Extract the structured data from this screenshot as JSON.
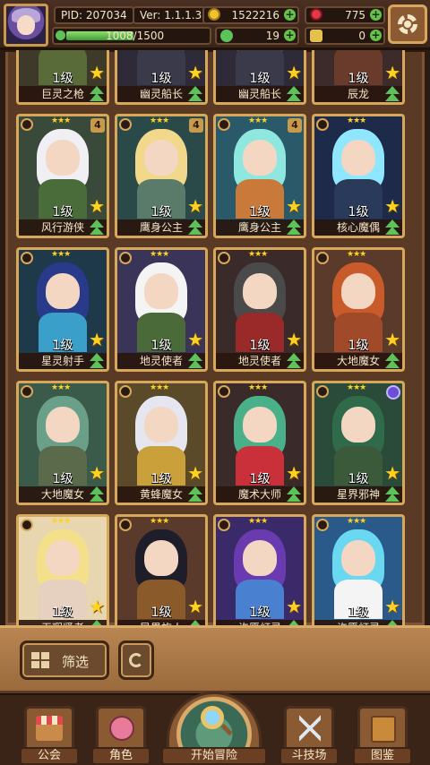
{
  "header": {
    "pid": "PID: 207034",
    "version": "Ver: 1.1.1.3",
    "coins": "1522216",
    "gems": "775",
    "xp_text": "1008/1500",
    "xp_progress": 0.672,
    "clovers": "19",
    "keys": "0",
    "plus": "+"
  },
  "cards": [
    {
      "name": "巨灵之枪",
      "level": "1级",
      "hair": "#7a3a2a",
      "body": "#5a6b3a",
      "bg": "#3d3a2a",
      "badge": ""
    },
    {
      "name": "幽灵船长",
      "level": "1级",
      "hair": "#4a4a5a",
      "body": "#3a3a4a",
      "bg": "#2e2a38",
      "badge": ""
    },
    {
      "name": "幽灵船长",
      "level": "1级",
      "hair": "#5a4a6a",
      "body": "#3a3a4a",
      "bg": "#2e2a38",
      "badge": ""
    },
    {
      "name": "辰龙",
      "level": "1级",
      "hair": "#4a2a2a",
      "body": "#6a3a2a",
      "bg": "#3d2a2a",
      "badge": ""
    },
    {
      "name": "风行游侠",
      "level": "1级",
      "hair": "#f0f0f4",
      "body": "#4a6b3a",
      "bg": "#3a4a3a",
      "badge": "4"
    },
    {
      "name": "鹰身公主",
      "level": "1级",
      "hair": "#f2d88a",
      "body": "#5a7a6a",
      "bg": "#2a4a4a",
      "badge": "4"
    },
    {
      "name": "鹰身公主",
      "level": "1级",
      "hair": "#8fe8e0",
      "body": "#c97a3a",
      "bg": "#2a5a6a",
      "badge": "4"
    },
    {
      "name": "核心魔偶",
      "level": "1级",
      "hair": "#8fe6ff",
      "body": "#2a3a5a",
      "bg": "#1e2a4a",
      "badge": ""
    },
    {
      "name": "星灵射手",
      "level": "1级",
      "hair": "#2a3a8a",
      "body": "#3aa0c9",
      "bg": "#1e3a4a",
      "badge": ""
    },
    {
      "name": "地灵使者",
      "level": "1级",
      "hair": "#f4f4f4",
      "body": "#4a6a3a",
      "bg": "#3a3458",
      "badge": ""
    },
    {
      "name": "地灵使者",
      "level": "1级",
      "hair": "#4a4a4a",
      "body": "#9a2a2a",
      "bg": "#3a2a2a",
      "badge": ""
    },
    {
      "name": "大地魔女",
      "level": "1级",
      "hair": "#c95a2a",
      "body": "#a04a2a",
      "bg": "#5a3a2a",
      "badge": ""
    },
    {
      "name": "大地魔女",
      "level": "1级",
      "hair": "#6aa08a",
      "body": "#5a6a4a",
      "bg": "#3a5a4a",
      "badge": ""
    },
    {
      "name": "黄蜂魔女",
      "level": "1级",
      "hair": "#e6e6f0",
      "body": "#c9a03a",
      "bg": "#5a4a2a",
      "badge": ""
    },
    {
      "name": "魔术大师",
      "level": "1级",
      "hair": "#4ab08a",
      "body": "#c9303a",
      "bg": "#3a2a2a",
      "badge": ""
    },
    {
      "name": "星界邪神",
      "level": "1级",
      "hair": "#2f6a4a",
      "body": "#3a5a3a",
      "bg": "#2a4a3a",
      "badge": "orb"
    },
    {
      "name": "无瑕贤者",
      "level": "1级",
      "hair": "#f4e08a",
      "body": "#e6d0c0",
      "bg": "#e8d6b0",
      "badge": ""
    },
    {
      "name": "异界旅人",
      "level": "1级",
      "hair": "#1e1e2a",
      "body": "#8a5a2a",
      "bg": "#5a3a2a",
      "badge": ""
    },
    {
      "name": "许愿灯灵",
      "level": "1级",
      "hair": "#6a3ab0",
      "body": "#4a80d0",
      "bg": "#3a2a6a",
      "badge": ""
    },
    {
      "name": "许愿灯灵",
      "level": "1级",
      "hair": "#6ad8f0",
      "body": "#f4f4f4",
      "bg": "#2a5a8a",
      "badge": ""
    }
  ],
  "filter": {
    "label": "筛选"
  },
  "nav": {
    "guild": "公会",
    "character": "角色",
    "adventure": "开始冒险",
    "arena": "斗技场",
    "codex": "图鉴"
  }
}
